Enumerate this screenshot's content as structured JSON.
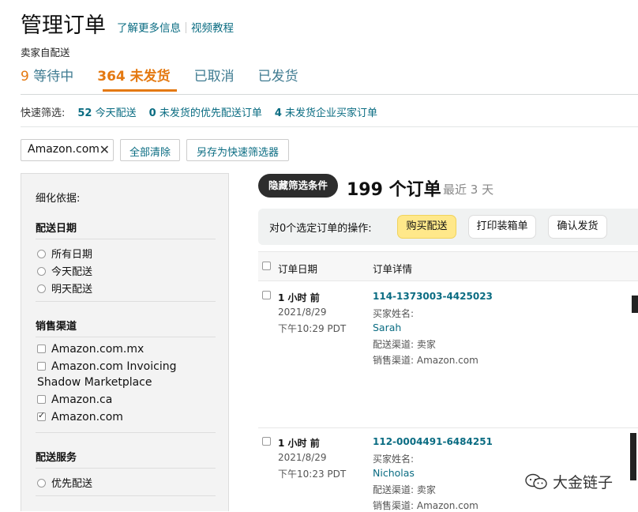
{
  "header": {
    "title": "管理订单",
    "link_more": "了解更多信息",
    "link_video": "视频教程",
    "subtitle": "卖家自配送"
  },
  "status_tabs": [
    {
      "count": "9",
      "label": "等待中"
    },
    {
      "count": "364",
      "label": "未发货"
    },
    {
      "label": "已取消"
    },
    {
      "label": "已发货"
    }
  ],
  "quick_filter": {
    "label": "快速筛选:",
    "items": [
      {
        "count": "52",
        "label": "今天配送"
      },
      {
        "count": "0",
        "label": "未发货的优先配送订单"
      },
      {
        "count": "4",
        "label": "未发货企业买家订单"
      }
    ]
  },
  "filters": {
    "chip_label": "Amazon.com",
    "clear_all": "全部清除",
    "save_filter": "另存为快速筛选器"
  },
  "sidebar": {
    "heading": "细化依据:",
    "sections": [
      {
        "title": "配送日期",
        "type": "radio",
        "options": [
          {
            "label": "所有日期"
          },
          {
            "label": "今天配送"
          },
          {
            "label": "明天配送"
          }
        ]
      },
      {
        "title": "销售渠道",
        "type": "checkbox",
        "options": [
          {
            "label": "Amazon.com.mx",
            "checked": false
          },
          {
            "label": "Amazon.com Invoicing",
            "label2": "Shadow Marketplace",
            "checked": false
          },
          {
            "label": "Amazon.ca",
            "checked": false
          },
          {
            "label": "Amazon.com",
            "checked": true
          }
        ]
      },
      {
        "title": "配送服务",
        "type": "radio",
        "options": [
          {
            "label": "优先配送"
          }
        ]
      }
    ]
  },
  "results": {
    "hide_filters": "隐藏筛选条件",
    "count_label": "199 个订单",
    "recent_label": "最近 3 天"
  },
  "action_bar": {
    "label": "对0个选定订单的操作:",
    "buy_shipping": "购买配送",
    "print_slip": "打印装箱单",
    "confirm_ship": "确认发货"
  },
  "table": {
    "col_date": "订单日期",
    "col_details": "订单详情",
    "rows": [
      {
        "time_ago": "1 小时 前",
        "date": "2021/8/29",
        "time": "下午10:29 PDT",
        "order_id": "114-1373003-4425023",
        "buyer_label": "买家姓名:",
        "buyer": "Sarah",
        "ship_channel": "配送渠道: 卖家",
        "sales_channel": "销售渠道: Amazon.com"
      },
      {
        "time_ago": "1 小时 前",
        "date": "2021/8/29",
        "time": "下午10:23 PDT",
        "order_id": "112-0004491-6484251",
        "buyer_label": "买家姓名:",
        "buyer": "Nicholas",
        "ship_channel": "配送渠道: 卖家",
        "sales_channel": "销售渠道: Amazon.com"
      }
    ]
  },
  "watermark": {
    "text": "大金链子"
  },
  "colors": {
    "accent_orange": "#e47911",
    "link_teal": "#0a6c82",
    "button_yellow": "#ffe88a"
  }
}
